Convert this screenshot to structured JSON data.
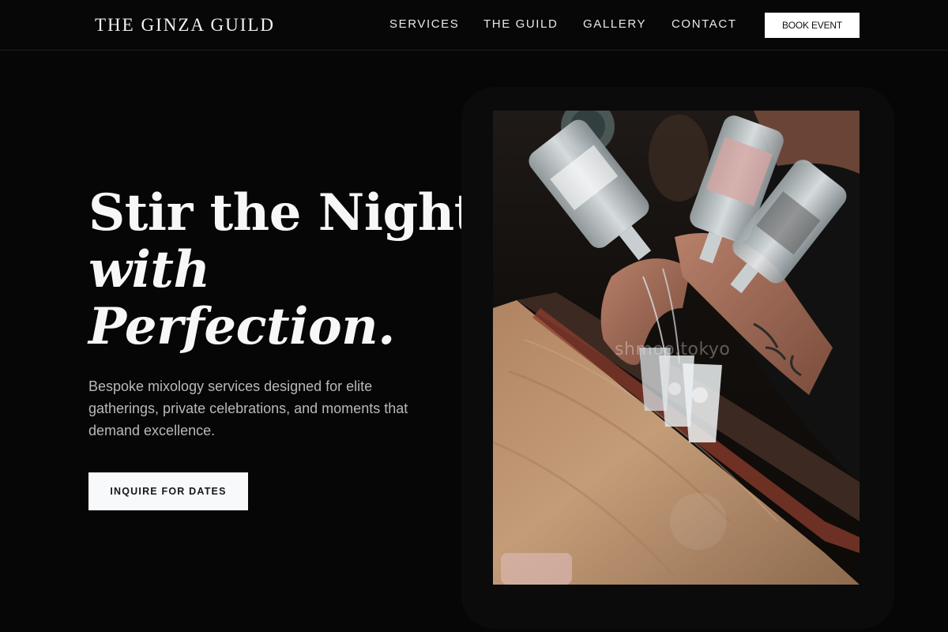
{
  "header": {
    "brand": "THE GINZA GUILD",
    "nav": [
      "SERVICES",
      "THE GUILD",
      "GALLERY",
      "CONTACT"
    ],
    "cta_label": "BOOK EVENT"
  },
  "hero": {
    "title_line1": "Stir the Night",
    "title_line2": "with",
    "title_line3": "Perfection.",
    "subtitle": "Bespoke mixology services designed for elite gatherings, private celebrations, and moments that demand excellence.",
    "cta_label": "INQUIRE FOR DATES"
  },
  "photo": {
    "watermark": "shmoo.tokyo"
  },
  "colors": {
    "background": "#060606",
    "text": "#f2f2f2",
    "muted_text": "#b9b9b9",
    "button_bg": "#ffffff",
    "button_text": "#111111"
  }
}
